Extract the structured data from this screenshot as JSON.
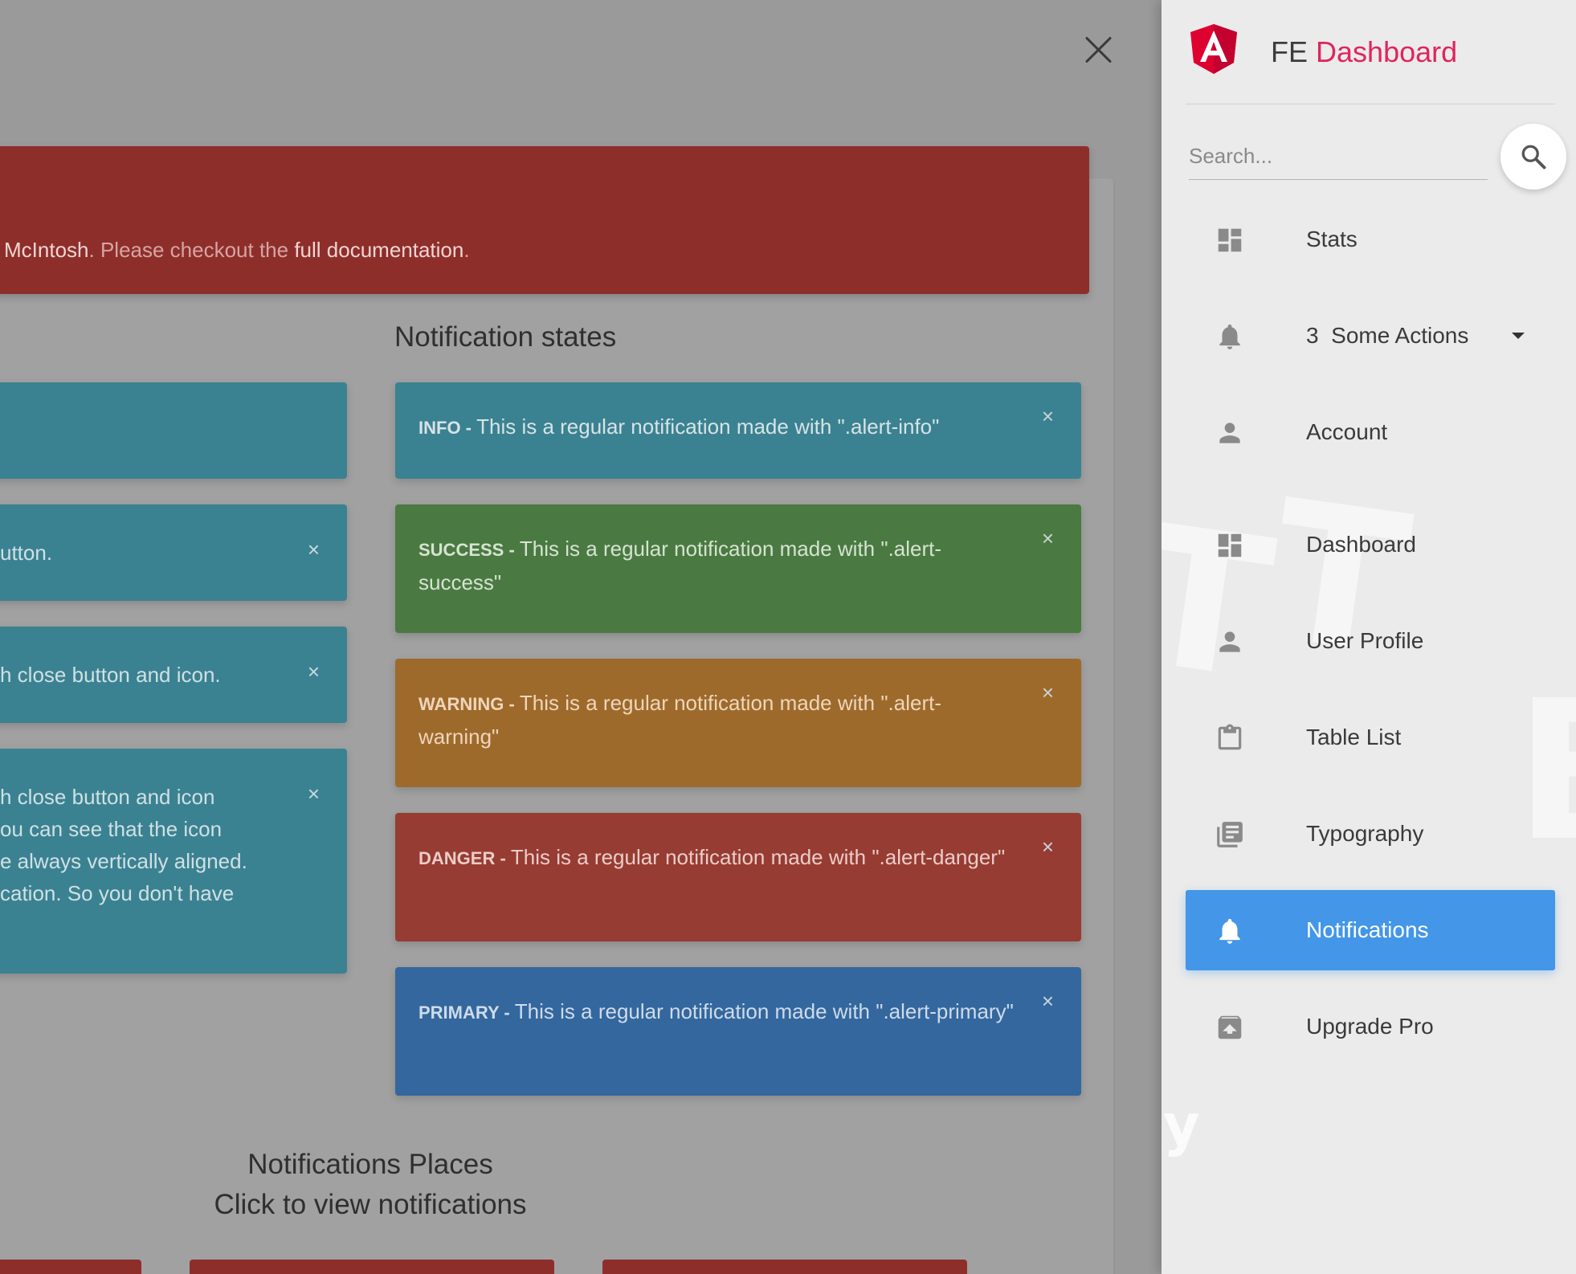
{
  "overlay": {
    "close_icon": "close-icon"
  },
  "header_banner": {
    "author": "McIntosh",
    "text_before_link": ". Please checkout the ",
    "link": "full documentation",
    "text_after_link": "."
  },
  "left_alerts": [
    {
      "text": "",
      "has_close": false
    },
    {
      "text": "utton.",
      "has_close": true
    },
    {
      "text": "h close button and icon.",
      "has_close": true
    },
    {
      "lines": [
        "h close button and icon",
        "ou can see that the icon",
        "e always vertically aligned.",
        "cation. So you don't have"
      ],
      "has_close": true
    }
  ],
  "states": {
    "title": "Notification states",
    "alerts": [
      {
        "label": "INFO - ",
        "text": "This is a regular notification made with \".alert-info\"",
        "close": "×",
        "color": "#3a8291"
      },
      {
        "label": "SUCCESS - ",
        "text": "This is a regular notification made with \".alert-success\"",
        "close": "×",
        "color": "#4a7a41"
      },
      {
        "label": "WARNING - ",
        "text": "This is a regular notification made with \".alert-warning\"",
        "close": "×",
        "color": "#9e6a2b"
      },
      {
        "label": "DANGER - ",
        "text": "This is a regular notification made with \".alert-danger\"",
        "close": "×",
        "color": "#963c33"
      },
      {
        "label": "PRIMARY - ",
        "text": "This is a regular notification made with \".alert-primary\"",
        "close": "×",
        "color": "#33679e"
      }
    ]
  },
  "places": {
    "title": "Notifications Places",
    "subtitle": "Click to view notifications"
  },
  "sidebar": {
    "brand_prefix": "FE",
    "brand_accent": "Dashboard",
    "accent_color": "#e0245e",
    "search_placeholder": "Search...",
    "search_icon": "search-icon",
    "items": [
      {
        "label": "Stats",
        "icon": "dashboard-icon"
      },
      {
        "badge": "3",
        "label": "Some Actions",
        "icon": "bell-icon",
        "has_caret": true
      },
      {
        "label": "Account",
        "icon": "person-icon"
      },
      {
        "label": "Dashboard",
        "icon": "dashboard-icon"
      },
      {
        "label": "User Profile",
        "icon": "person-icon"
      },
      {
        "label": "Table List",
        "icon": "clipboard-icon"
      },
      {
        "label": "Typography",
        "icon": "library-books-icon"
      },
      {
        "label": "Notifications",
        "icon": "bell-icon",
        "active": true
      },
      {
        "label": "Upgrade Pro",
        "icon": "unarchive-icon"
      }
    ],
    "active_color": "#4396e8"
  }
}
